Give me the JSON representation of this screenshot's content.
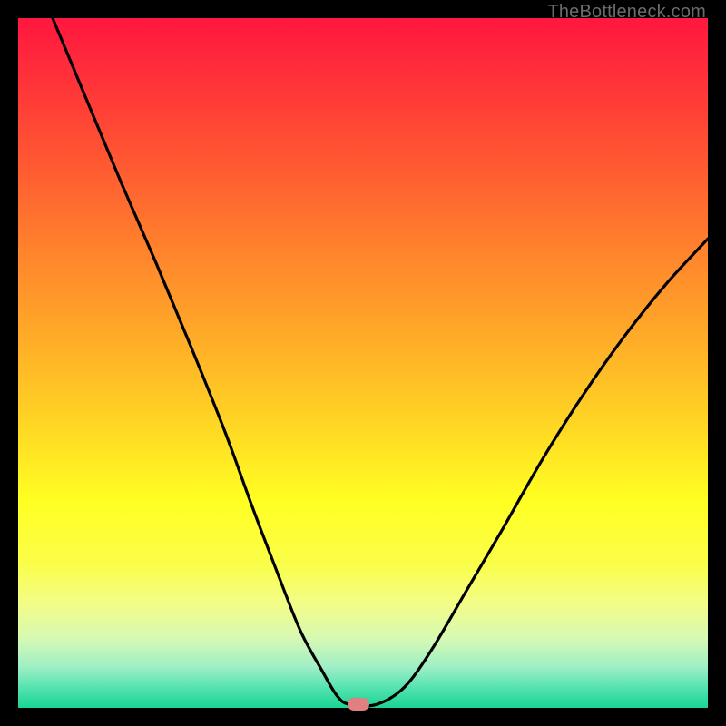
{
  "watermark": "TheBottleneck.com",
  "marker": {
    "x_frac": 0.493,
    "y_frac": 0.995,
    "color": "#e08080"
  },
  "chart_data": {
    "type": "line",
    "title": "",
    "xlabel": "",
    "ylabel": "",
    "xlim": [
      0,
      1
    ],
    "ylim": [
      0,
      1
    ],
    "series": [
      {
        "name": "bottleneck-curve",
        "x": [
          0.05,
          0.1,
          0.15,
          0.2,
          0.25,
          0.3,
          0.34,
          0.38,
          0.41,
          0.44,
          0.462,
          0.48,
          0.52,
          0.56,
          0.6,
          0.65,
          0.7,
          0.76,
          0.82,
          0.88,
          0.94,
          1.0
        ],
        "values": [
          1.0,
          0.88,
          0.76,
          0.645,
          0.525,
          0.4,
          0.29,
          0.185,
          0.11,
          0.055,
          0.018,
          0.005,
          0.005,
          0.03,
          0.085,
          0.17,
          0.255,
          0.36,
          0.455,
          0.54,
          0.615,
          0.68
        ]
      }
    ],
    "annotations": [
      {
        "type": "marker",
        "x": 0.493,
        "y": 0.005,
        "color": "#e08080",
        "shape": "pill"
      }
    ]
  }
}
